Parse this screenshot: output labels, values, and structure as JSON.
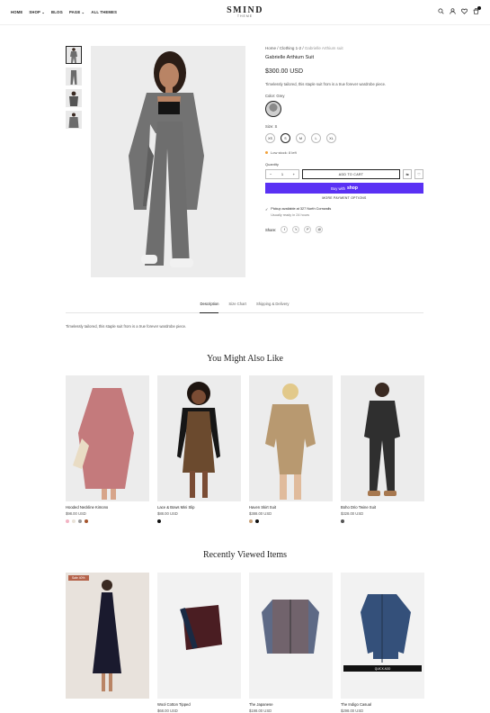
{
  "header": {
    "nav": [
      "HOME",
      "SHOP",
      "BLOG",
      "PAGE",
      "ALL THEMES"
    ],
    "logo": "SMIND",
    "logo_sub": "THEME",
    "cart_count": ""
  },
  "breadcrumb": {
    "home": "Home",
    "sep1": "/",
    "cat": "Clothing 1-2",
    "sep2": "/",
    "current": "Gabrielle Arthium suit"
  },
  "product": {
    "title": "Gabrielle Arthium Suit",
    "price": "$300.00 USD",
    "description": "Timelessly tailored, this staple suit from is a true forever wardrobe piece.",
    "color_label": "Color: Grey",
    "size_label": "Size: S",
    "sizes": [
      "XS",
      "S",
      "M",
      "L",
      "XL"
    ],
    "stock": "Low stock: 8 left",
    "quantity_label": "Quantity",
    "quantity": "1",
    "add_to_cart": "ADD TO CART",
    "buy_with": "Buy with",
    "buy_brand": "shop",
    "more_options": "MORE PAYMENT OPTIONS",
    "pickup": "Pickup available at 327 North Cornwalls",
    "pickup_sub": "Usually ready in 24 hours",
    "share_label": "Share:"
  },
  "tabs": [
    "Description",
    "Size Chart",
    "Shipping & Delivery"
  ],
  "tab_content": "Timelessly tailored, this staple suit from is a true forever wardrobe piece.",
  "related": {
    "title": "You Might Also Like",
    "items": [
      {
        "name": "Hooded Neckline Kimono",
        "price": "$98.00 USD",
        "colors": [
          "#f2b4c4",
          "#e9e2d8",
          "#9a9a9a",
          "#a5552e"
        ]
      },
      {
        "name": "Lace & Bows Mini Slip",
        "price": "$88.00 USD",
        "colors": [
          "#111111"
        ]
      },
      {
        "name": "Haven Skirt Suit",
        "price": "$388.00 USD",
        "colors": [
          "#c9a27a",
          "#111111"
        ]
      },
      {
        "name": "Boho Drio Twine Suit",
        "price": "$328.00 USD",
        "colors": [
          "#555555"
        ]
      }
    ]
  },
  "recent": {
    "title": "Recently Viewed Items",
    "items": [
      {
        "name": "",
        "price": "",
        "badge": "Sale 40%"
      },
      {
        "name": "Wool Cotton Tipped",
        "price": "$68.00 USD"
      },
      {
        "name": "The Japanese",
        "price": "$198.00 USD"
      },
      {
        "name": "The Indigo Casual",
        "price": "$298.00 USD",
        "quick": "QUICK ADD"
      }
    ]
  }
}
